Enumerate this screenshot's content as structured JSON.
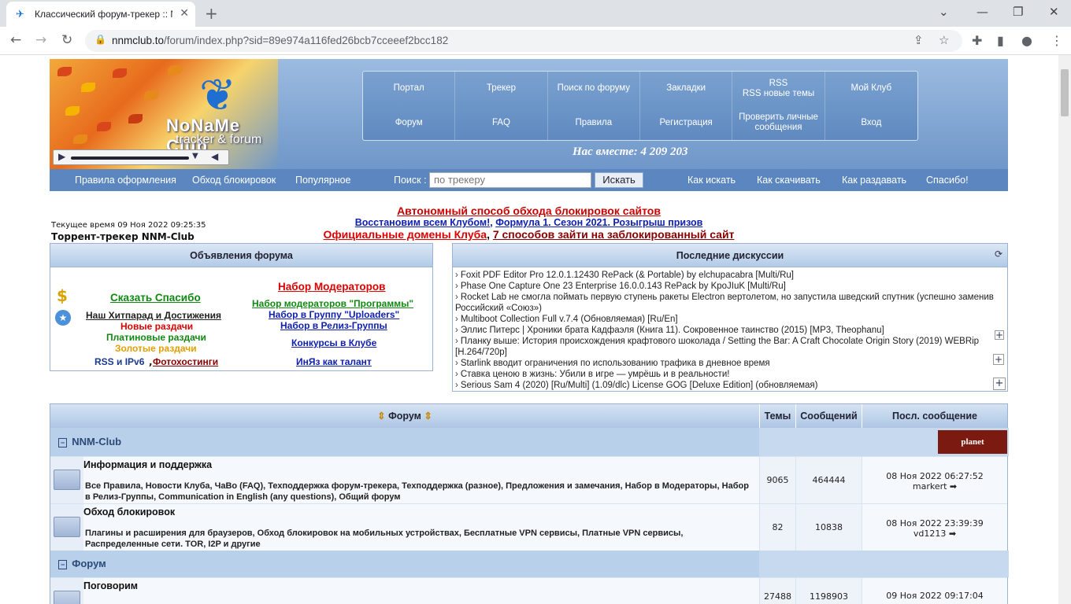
{
  "browser": {
    "tab_title": "Классический форум-трекер :: N",
    "url_host": "nnmclub.to",
    "url_path": "/forum/index.php?sid=89e974a116fed26bcb7cceeef2bcc182"
  },
  "header": {
    "logo_line1": "NoNaMe Club",
    "logo_line2": "tracker & forum",
    "nav_top": [
      "Портал",
      "Трекер",
      "Поиск по форуму",
      "Закладки",
      "RSS\nRSS новые темы",
      "Мой Клуб"
    ],
    "nav_bottom": [
      "Форум",
      "FAQ",
      "Правила",
      "Регистрация",
      "Проверить личные сообщения",
      "Вход"
    ],
    "together": "Нас вместе: 4 209 203"
  },
  "subbar": {
    "rules": "Правила оформления",
    "bypass": "Обход блокировок",
    "popular": "Популярное",
    "search_label": "Поиск :",
    "search_placeholder": "по трекеру",
    "search_button": "Искать",
    "how_search": "Как искать",
    "how_download": "Как скачивать",
    "how_seed": "Как раздавать",
    "thanks": "Спасибо!"
  },
  "info": {
    "current_time": "Текущее время 09 Ноя 2022 09:25:35",
    "tracker_name": "Торрент-трекер NNM-Club",
    "line1": "Автономный способ обхода блокировок сайтов",
    "line2a": "Восстановим всем Клубом!",
    "line2b": "Формула 1. Сезон 2021. Розыгрыш призов",
    "line3a": "Официальные домены Клуба",
    "line3b": "7 способов зайти на заблокированный сайт"
  },
  "announcements": {
    "title": "Объявления форума",
    "say_thanks": "Сказать Спасибо",
    "hitparade": "Наш Хитпарад и Достижения",
    "new_releases": "Новые раздачи",
    "platinum": "Платиновые раздачи",
    "golden": "Золотые раздачи",
    "rss": "RSS и IPv6",
    "photohosting": "Фотохостинги",
    "moderators": "Набор Модераторов",
    "mod_programs": "Набор модераторов \"Программы\"",
    "uploaders": "Набор в Группу \"Uploaders\"",
    "release_group": "Набор в Релиз-Группы",
    "contests": "Конкурсы в Клубе",
    "languages": "ИнЯз как талант"
  },
  "discussions": {
    "title": "Последние дискуссии",
    "items": [
      "Foxit PDF Editor Pro 12.0.1.12430 RePack (& Portable) by elchupacabra [Multi/Ru]",
      "Phase One Capture One 23 Enterprise 16.0.0.143 RePack by KpoJIuK [Multi/Ru]",
      "Rocket Lab не смогла поймать первую ступень ракеты Electron вертолетом, но запустила шведский спутник (успешно заменив Российский «Союз»)",
      "Multiboot Collection Full v.7.4 (Обновляемая) [Ru/En]",
      "Эллис Питерс | Хроники брата Кадфаэля (Книга 11). Сокровенное таинство (2015) [MP3, Theophanu]",
      "Планку выше: История происхождения крафтового шоколада / Setting the Bar: A Craft Chocolate Origin Story (2019) WEBRip [H.264/720p]",
      "Starlink вводит ограничения по использованию трафика в дневное время",
      "Ставка ценою в жизнь: Убили в игре — умрёшь и в реальности!",
      "Serious Sam 4 (2020) [Ru/Multi] (1.09/dlc) License GOG [Deluxe Edition] (обновляемая)"
    ]
  },
  "forum_table": {
    "col_forum": "Форум",
    "col_topics": "Темы",
    "col_posts": "Сообщений",
    "col_last": "Посл. сообщение",
    "cat1": "NNM-Club",
    "planet_logo": "planet",
    "cat2": "Форум",
    "forums": [
      {
        "title": "Информация и поддержка",
        "subs": "Все Правила, Новости Клуба, ЧаВо (FAQ), Техподдержка форум-трекера, Техподдержка (разное), Предложения и замечания, Набор в Модераторы, Набор в Релиз-Группы, Communication in English (any questions), Общий форум",
        "topics": "9065",
        "posts": "464444",
        "last_date": "08 Ноя 2022 06:27:52",
        "last_user": "markert"
      },
      {
        "title": "Обход блокировок",
        "subs": "Плагины и расширения для браузеров, Обход блокировок на мобильных устройствах, Бесплатные VPN сервисы, Платные VPN сервисы, Распределенные сети. TOR, I2P и другие",
        "topics": "82",
        "posts": "10838",
        "last_date": "08 Ноя 2022 23:39:39",
        "last_user": "vd1213"
      },
      {
        "title": "Поговорим",
        "subs": "",
        "topics": "27488",
        "posts": "1198903",
        "last_date": "09 Ноя 2022 09:17:04",
        "last_user": ""
      }
    ]
  }
}
